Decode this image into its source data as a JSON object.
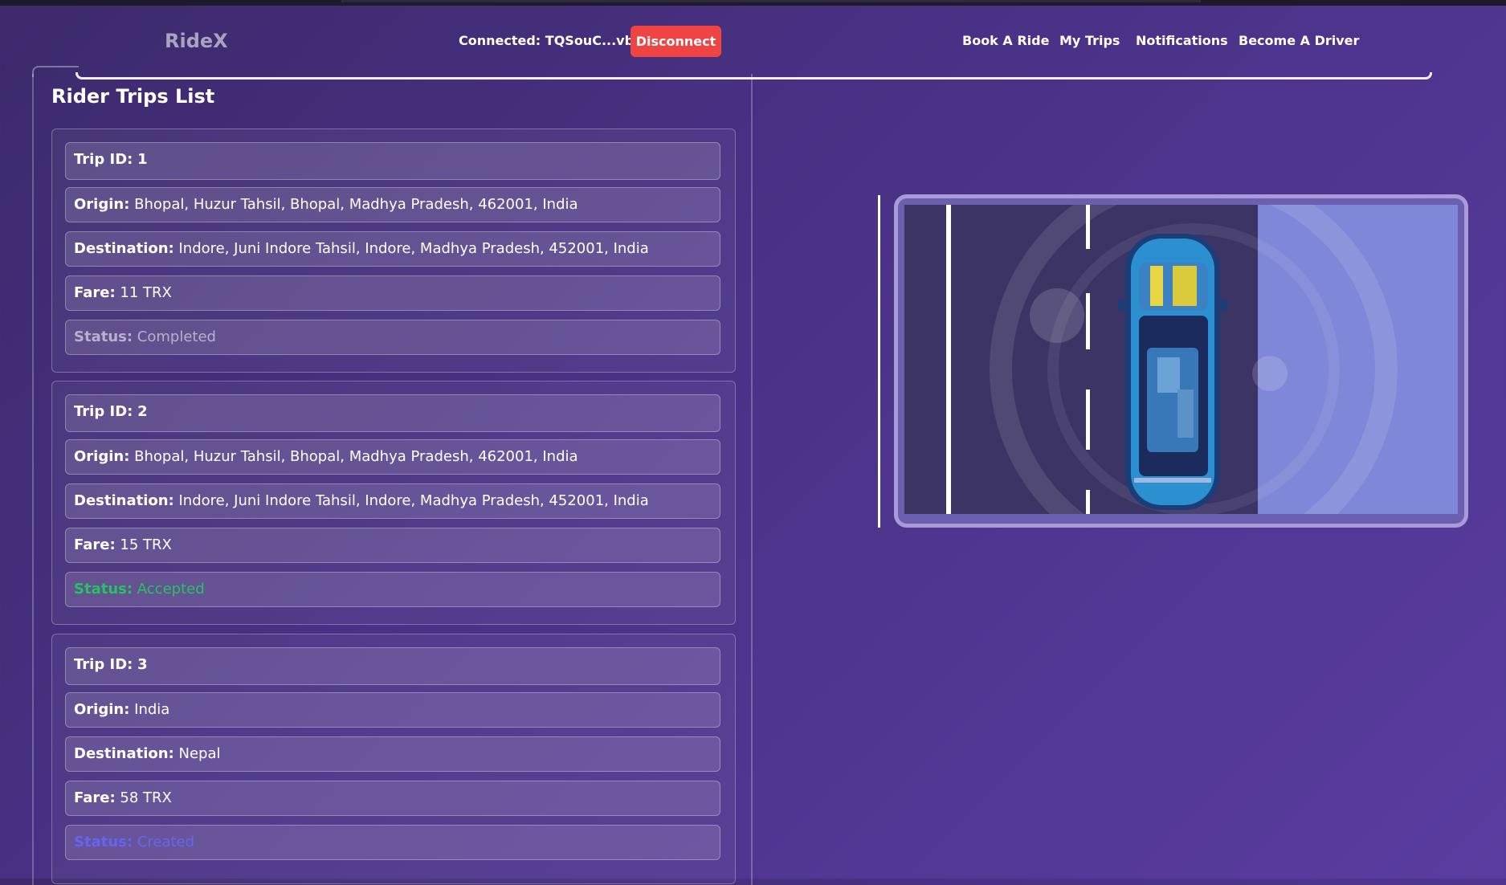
{
  "app": {
    "brand": "RideX"
  },
  "header": {
    "connected_label": "Connected: TQSouC...vbGY",
    "disconnect_label": "Disconnect",
    "nav": [
      "Book A Ride",
      "My Trips",
      "Notifications",
      "Become A Driver"
    ]
  },
  "page": {
    "title": "Rider Trips List"
  },
  "labels": {
    "trip_id": "Trip ID:",
    "origin": "Origin:",
    "destination": "Destination:",
    "fare": "Fare:",
    "status": "Status:"
  },
  "trips": [
    {
      "id": "1",
      "origin": "Bhopal, Huzur Tahsil, Bhopal, Madhya Pradesh, 462001, India",
      "destination": "Indore, Juni Indore Tahsil, Indore, Madhya Pradesh, 452001, India",
      "fare": "11 TRX",
      "status": "Completed"
    },
    {
      "id": "2",
      "origin": "Bhopal, Huzur Tahsil, Bhopal, Madhya Pradesh, 462001, India",
      "destination": "Indore, Juni Indore Tahsil, Indore, Madhya Pradesh, 452001, India",
      "fare": "15 TRX",
      "status": "Accepted"
    },
    {
      "id": "3",
      "origin": "India",
      "destination": "Nepal",
      "fare": "58 TRX",
      "status": "Created"
    }
  ],
  "colors": {
    "disconnect": "#ef4444",
    "status_completed": "#b8b0cc",
    "status_accepted": "#22c55e",
    "status_created": "#6366f1"
  },
  "illustration": {
    "icon": "car-top-view-icon"
  }
}
